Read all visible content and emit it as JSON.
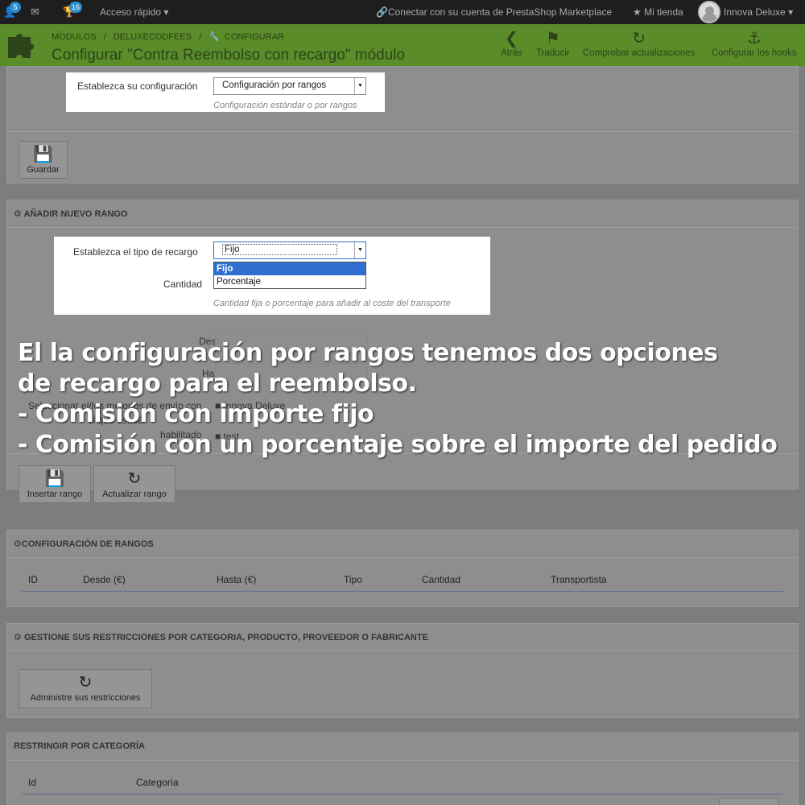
{
  "topbar": {
    "user_badge": "5",
    "trophy_badge": "16",
    "quick_access": "Acceso rápido",
    "connect_link": "Conectar con su cuenta de PrestaShop Marketplace",
    "my_store": "Mi tienda",
    "user_name": "Innova Deluxe"
  },
  "header": {
    "breadcrumbs": [
      "MÓDULOS",
      "/",
      "DELUXECODFEES",
      "/",
      "CONFIGURAR"
    ],
    "title": "Configurar \"Contra Reembolso con recargo\" módulo",
    "buttons": [
      {
        "label": "Atrás",
        "icon": "back-arrow-icon"
      },
      {
        "label": "Traducir",
        "icon": "flag-icon"
      },
      {
        "label": "Comprobar actualizaciones",
        "icon": "refresh-icon"
      },
      {
        "label": "Configurar los hooks",
        "icon": "anchor-icon"
      }
    ]
  },
  "config": {
    "label": "Establezca su configuración",
    "selected": "Configuración por rangos",
    "hint": "Configuración estándar o por rangos",
    "save_label": "Guardar"
  },
  "new_range": {
    "title": "AÑADIR NUEVO RANGO",
    "type_label": "Establezca el tipo de recargo",
    "type_selected": "Fijo",
    "options": [
      "Fijo",
      "Porcentaje"
    ],
    "amount_label": "Cantidad",
    "amount_hint": "Cantidad fija o porcentaje para añadir al coste del transporte",
    "from_label": "Desde",
    "to_label": "Hasta",
    "carriers_label_1": "Seleccionar el/los métodos de envío con",
    "carriers_label_2": "el que estará",
    "carriers_label_3": "habilitado",
    "carrier_1": "Innova Deluxe",
    "carrier_2": "test",
    "insert_label": "Insertar rango",
    "update_label": "Actualizar rango"
  },
  "ranges": {
    "title": "CONFIGURACIÓN DE RANGOS",
    "columns": [
      "ID",
      "Desde (€)",
      "Hasta (€)",
      "Tipo",
      "Cantidad",
      "Transportista"
    ]
  },
  "restrictions": {
    "title": "GESTIONE SUS RESTRICCIONES POR CATEGORIA, PRODUCTO, PROVEEDOR O FABRICANTE",
    "manage_label": "Administre sus restricciones"
  },
  "category": {
    "title": "RESTRINGIR POR CATEGORÍA",
    "columns": [
      "Id",
      "Categoría"
    ]
  },
  "overlay": {
    "line1": "El la configuración por rangos tenemos dos opciones",
    "line2": "de recargo para el reembolso.",
    "line3": "- Comisión con importe fijo",
    "line4": "- Comisión con un porcentaje sobre el importe del pedido"
  }
}
